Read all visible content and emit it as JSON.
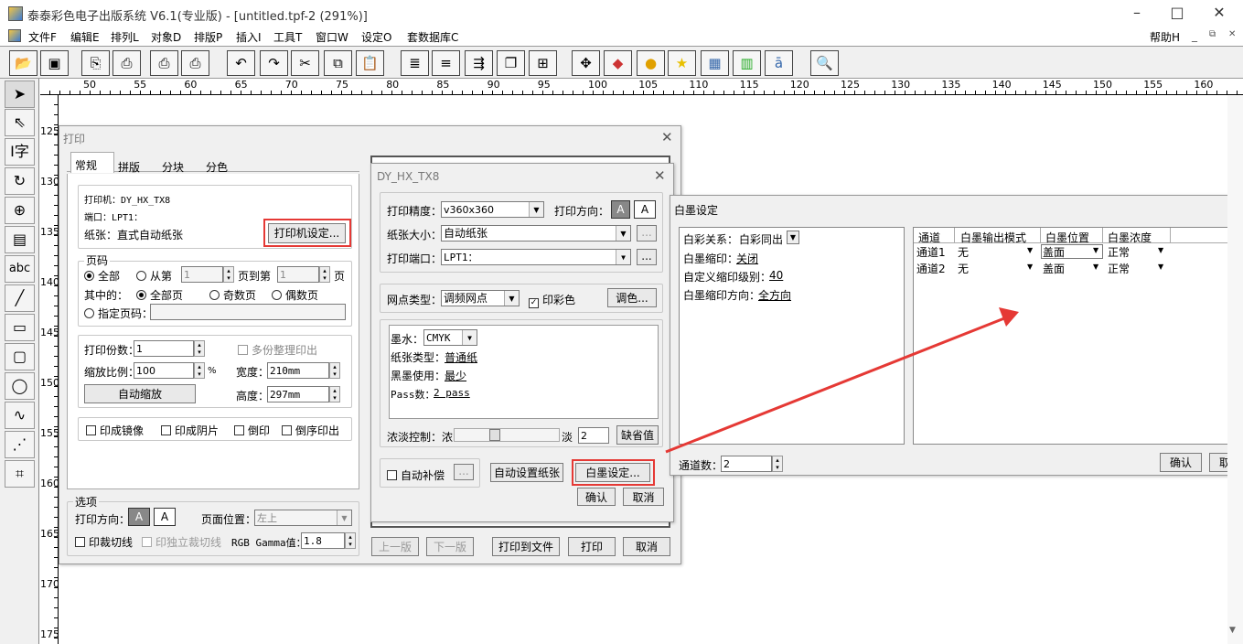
{
  "app": {
    "title": "泰泰彩色电子出版系统 V6.1(专业版) - [untitled.tpf-2 (291%)]"
  },
  "menu": {
    "items": [
      "文件F",
      "编辑E",
      "排列L",
      "对象D",
      "排版P",
      "插入I",
      "工具T",
      "窗口W",
      "设定O",
      "套数据库C"
    ],
    "help": "帮助H"
  },
  "ruler": {
    "h": [
      "50",
      "55",
      "60",
      "65",
      "70",
      "75",
      "80",
      "85",
      "90",
      "95",
      "100",
      "105",
      "110",
      "115",
      "120",
      "125",
      "130",
      "135",
      "140",
      "145",
      "150",
      "155",
      "160"
    ],
    "v": [
      "125",
      "130",
      "135",
      "140",
      "145",
      "150",
      "155",
      "160",
      "165",
      "170",
      "175"
    ]
  },
  "print": {
    "title": "打印",
    "tabs": [
      "常规",
      "拼版",
      "分块",
      "分色"
    ],
    "printer": "打印机：DY_HX_TX8",
    "port": "端口：LPT1：",
    "paper": "纸张：直式自动纸张",
    "printer_setup": "打印机设定...",
    "page_group": "页码",
    "all": "全部",
    "from": "从第",
    "from_val": "1",
    "to": "页到第",
    "to_val": "1",
    "page": "页",
    "among": "其中的：",
    "all_pages": "全部页",
    "odd": "奇数页",
    "even": "偶数页",
    "specify": "指定页码：",
    "copies_lbl": "打印份数：",
    "copies": "1",
    "collate": "多份整理印出",
    "scale_lbl": "缩放比例：",
    "scale": "100",
    "scale_unit": "%",
    "width_lbl": "宽度：",
    "width": "210mm",
    "height_lbl": "高度：",
    "height": "297mm",
    "autoscale": "自动缩放",
    "mirror": "印成镜像",
    "negative": "印成阴片",
    "upside": "倒印",
    "reverse": "倒序印出",
    "options": "选项",
    "orient": "打印方向：",
    "page_pos": "页面位置：",
    "page_pos_val": "左上",
    "crop": "印裁切线",
    "indcrop": "印独立裁切线",
    "gamma_lbl": "RGB Gamma值：",
    "gamma": "1.8",
    "prev": "上一版",
    "next": "下一版",
    "to_file": "打印到文件",
    "print": "打印",
    "cancel": "取消"
  },
  "hx": {
    "title": "DY_HX_TX8",
    "precision_lbl": "打印精度：",
    "precision": "v360x360",
    "direction": "打印方向：",
    "size_lbl": "纸张大小：",
    "size": "自动纸张",
    "port_lbl": "打印端口：",
    "port": "LPT1：",
    "dot_lbl": "网点类型：",
    "dot": "调频网点",
    "colorprint": "印彩色",
    "tone": "调色...",
    "ink_lbl": "墨水：",
    "ink": "CMYK",
    "ptype_lbl": "纸张类型：",
    "ptype": "普通纸",
    "black_lbl": "黑墨使用：",
    "black": "最少",
    "pass_lbl": "Pass数：",
    "pass": "2 pass",
    "density_lbl": "浓淡控制：浓",
    "light": "淡",
    "density": "2",
    "default": "缺省值",
    "autocomp": "自动补偿",
    "autopaper": "自动设置纸张",
    "white": "白墨设定...",
    "ok": "确认",
    "cancel": "取消"
  },
  "wd": {
    "title": "白墨设定",
    "rel_lbl": "白彩关系：",
    "rel": "白彩同出",
    "shrink_lbl": "白墨缩印：",
    "shrink": "关闭",
    "level_lbl": "自定义缩印级别：",
    "level": "40",
    "dir_lbl": "白墨缩印方向：",
    "dir": "全方向",
    "headers": [
      "通道",
      "白墨输出模式",
      "白墨位置",
      "白墨浓度"
    ],
    "rows": [
      [
        "通道1",
        "无",
        "盖面",
        "正常"
      ],
      [
        "通道2",
        "无",
        "盖面",
        "正常"
      ]
    ],
    "channels_lbl": "通道数：",
    "channels": "2",
    "ok": "确认",
    "cancel": "取消"
  },
  "colors": {
    "accent": "#e53935"
  }
}
